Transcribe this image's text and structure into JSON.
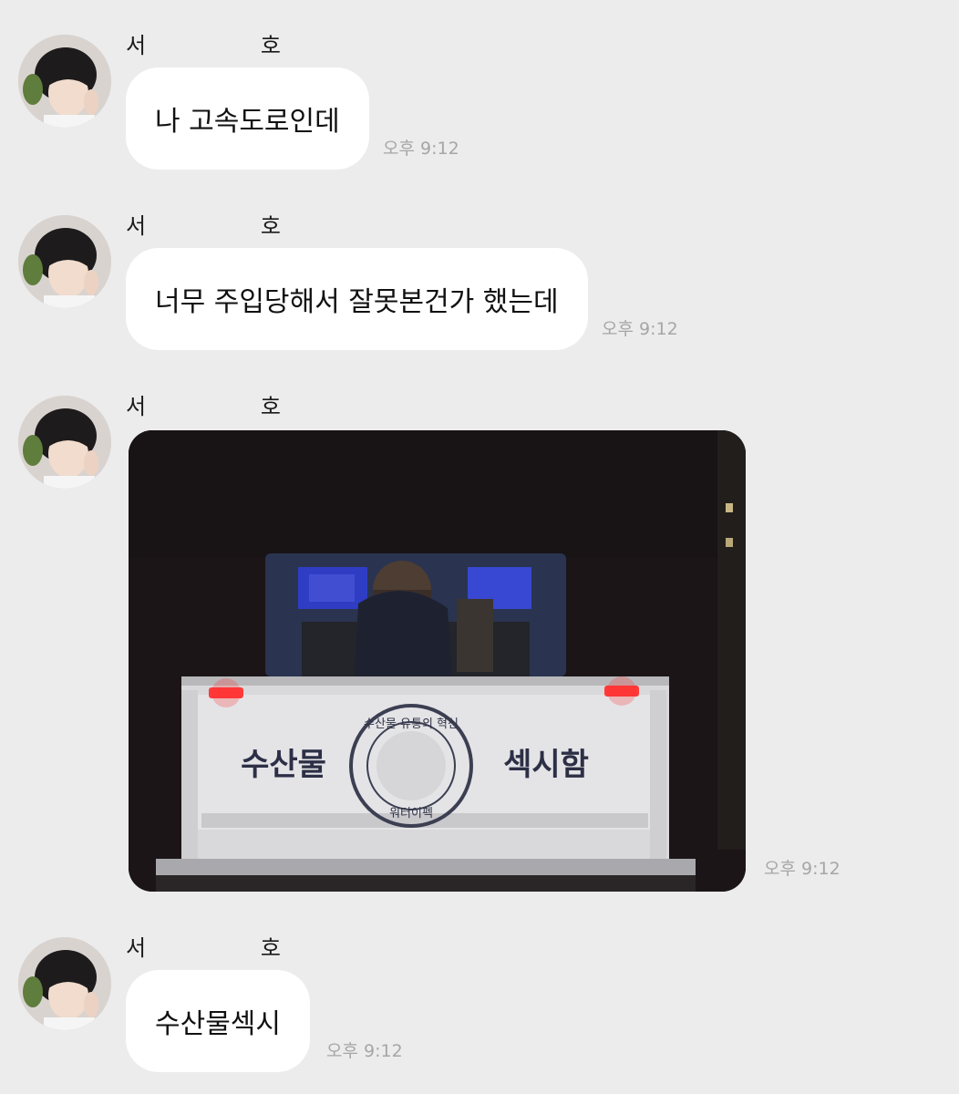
{
  "messages": [
    {
      "sender_first": "서",
      "sender_last": "호",
      "text": "나 고속도로인데",
      "time": "오후 9:12"
    },
    {
      "sender_first": "서",
      "sender_last": "호",
      "text": "너무 주입당해서 잘못본건가 했는데",
      "time": "오후 9:12"
    },
    {
      "sender_first": "서",
      "sender_last": "호",
      "photo": {
        "left_sign": "수산물",
        "right_sign": "섹시함",
        "emblem_top": "수산물 유통의 혁신",
        "emblem_bottom": "워터이펙"
      },
      "time": "오후 9:12"
    },
    {
      "sender_first": "서",
      "sender_last": "호",
      "text": "수산물섹시",
      "time": "오후 9:12"
    }
  ],
  "colors": {
    "background": "#ececec",
    "bubble": "#ffffff",
    "time_text": "#a6a6a6"
  },
  "icons": {
    "avatar": "profile-photo"
  }
}
